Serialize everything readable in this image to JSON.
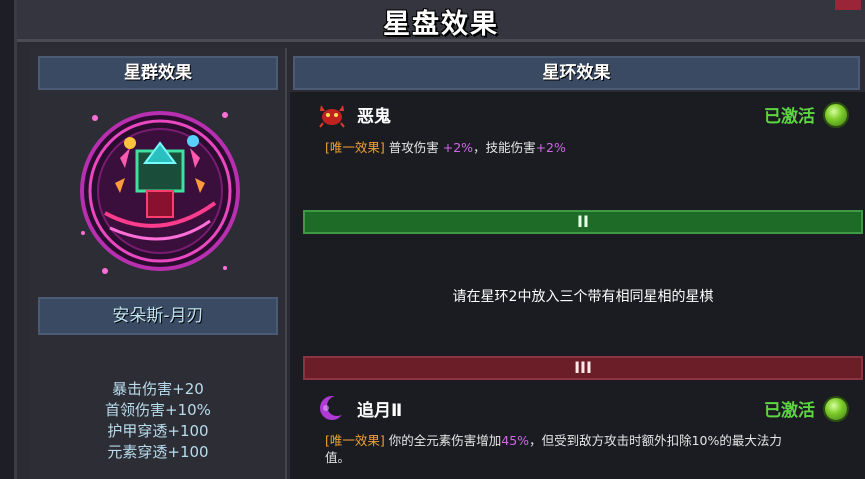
{
  "title": "星盘效果",
  "left_panel": {
    "header": "星群效果",
    "constellation_name": "安朵斯-月刃",
    "stats": [
      "暴击伤害+20",
      "首领伤害+10%",
      "护甲穿透+100",
      "元素穿透+100"
    ]
  },
  "right_panel": {
    "header": "星环效果",
    "ring1": {
      "name": "恶鬼",
      "icon": "demon-crab-icon",
      "status": "已激活",
      "tag": "[唯一效果]",
      "effect_a": "普攻伤害",
      "value_a": "+2%",
      "effect_b": "，技能伤害",
      "value_b": "+2%"
    },
    "ring2": {
      "label": "II",
      "message": "请在星环2中放入三个带有相同星相的星棋"
    },
    "ring3": {
      "label": "III",
      "name": "追月Ⅱ",
      "icon": "crescent-moon-icon",
      "status": "已激活",
      "tag": "[唯一效果]",
      "effect_a": "你的全元素伤害增加",
      "value_a": "45%",
      "effect_b": "，但受到敌方攻击时额外扣除10%的最大法力",
      "effect_c": "值。"
    }
  },
  "colors": {
    "active_green": "#5ed442",
    "tag_orange": "#f0a030",
    "value_purple": "#d266e8",
    "ring2_bar": "#1e6b27",
    "ring3_bar": "#6b1d28"
  }
}
